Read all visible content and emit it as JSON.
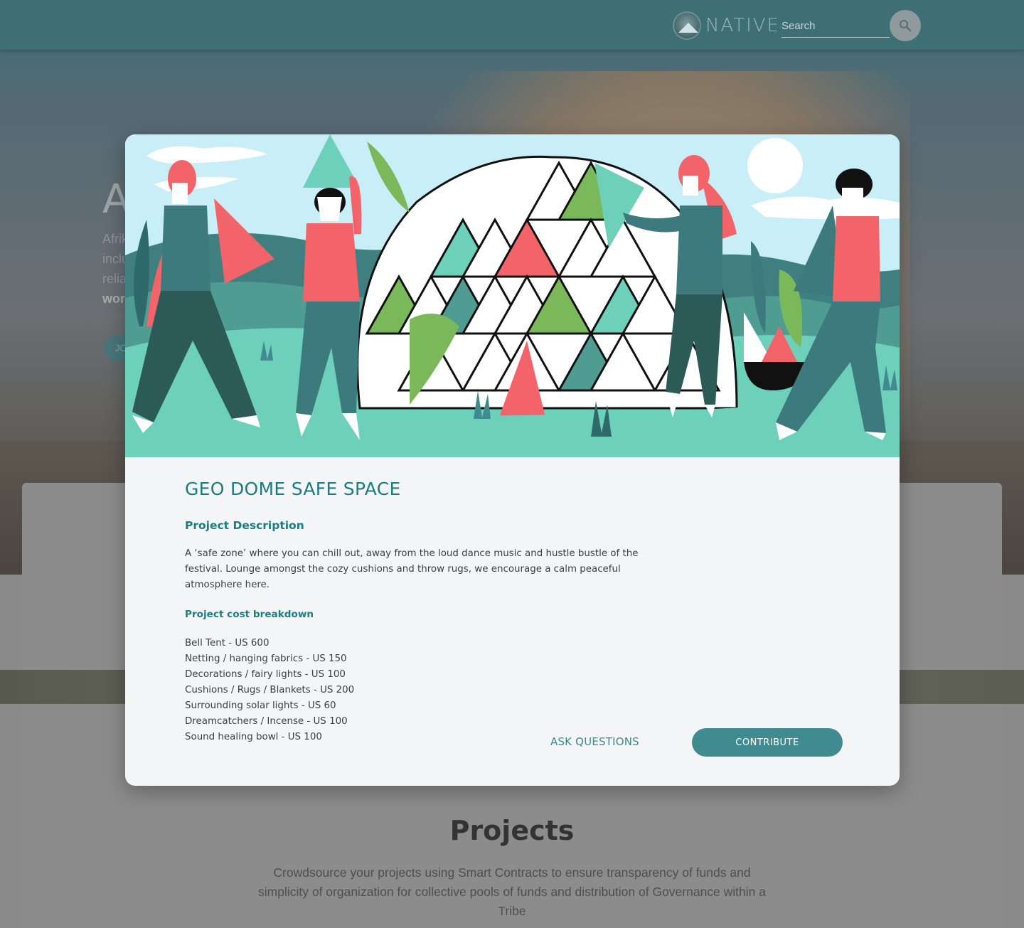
{
  "header": {
    "brand_name": "NATIVE",
    "search_placeholder": "Search"
  },
  "hero": {
    "title_partial": "A",
    "line_1": "Afrik",
    "line_2": "inclu",
    "line_3": "relia",
    "line_4_bold": "wor",
    "join_button": "JO"
  },
  "projects": {
    "title": "Projects",
    "description": "Crowdsource your projects using Smart Contracts to ensure transparency of funds and simplicity of organization for collective pools of funds and distribution of Governance within a Tribe"
  },
  "modal": {
    "title": "GEO DOME SAFE SPACE",
    "description_heading": "Project Description",
    "description": "A ‘safe zone’ where you can chill out, away from the loud dance music and hustle bustle of the festival. Lounge amongst the cozy cushions and throw rugs, we encourage a calm peaceful atmosphere here.",
    "cost_heading": "Project cost breakdown",
    "cost_items": [
      "Bell Tent - US 600",
      "Netting / hanging fabrics - US 150",
      "Decorations / fairy lights - US 100",
      "Cushions / Rugs / Blankets - US 200",
      "Surrounding solar lights - US 60",
      "Dreamcatchers / Incense - US 100",
      "Sound healing bowl - US 100"
    ],
    "ask_button": "ASK QUESTIONS",
    "contribute_button": "CONTRIBUTE"
  },
  "colors": {
    "accent": "#1b7d80",
    "button": "#3f8b8f",
    "illustration_sky": "#c8eef7",
    "illustration_ground": "#6dd0bb",
    "red": "#f2636a",
    "green": "#7ab85a",
    "teal": "#3d7a7d"
  },
  "icons": {
    "search": "search-icon",
    "logo": "native-logo-icon"
  }
}
